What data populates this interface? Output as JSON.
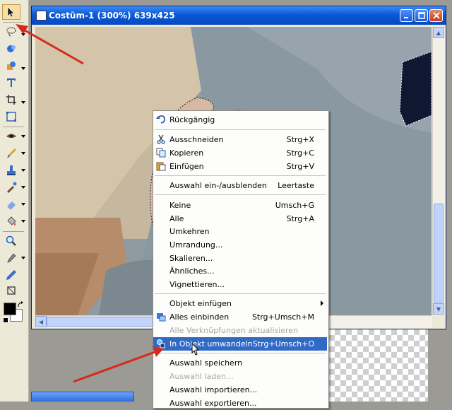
{
  "window": {
    "title": "Costüm-1 (300%) 639x425",
    "buttons": {
      "minimize": "minimize-icon",
      "maximize": "maximize-icon",
      "close": "close-icon"
    }
  },
  "toolbox": {
    "tools": [
      {
        "name": "pointer-tool",
        "icon": "arrow-pointer-icon",
        "active": true
      },
      {
        "name": "lasso-tool",
        "icon": "lasso-icon"
      },
      {
        "name": "magic-wand-tool",
        "icon": "magic-wand-icon"
      },
      {
        "name": "shape-tool",
        "icon": "shapes-icon"
      },
      {
        "name": "text-tool",
        "icon": "text-icon"
      },
      {
        "name": "crop-tool",
        "icon": "crop-icon"
      },
      {
        "name": "transform-tool",
        "icon": "transform-icon"
      },
      {
        "name": "eye-tool",
        "icon": "eye-icon"
      },
      {
        "name": "brush-tool",
        "icon": "brush-icon"
      },
      {
        "name": "stamp-tool",
        "icon": "stamp-icon"
      },
      {
        "name": "airbrush-tool",
        "icon": "airbrush-icon"
      },
      {
        "name": "eraser-tool",
        "icon": "eraser-icon"
      },
      {
        "name": "fill-tool",
        "icon": "paint-bucket-icon"
      },
      {
        "name": "zoom-tool",
        "icon": "magnifier-icon"
      },
      {
        "name": "eyedropper-tool",
        "icon": "eyedropper-icon"
      },
      {
        "name": "pen-tool",
        "icon": "pen-icon"
      },
      {
        "name": "hand-tool",
        "icon": "hand-icon"
      }
    ],
    "colors": {
      "foreground": "#000000",
      "background": "#ffffff"
    }
  },
  "context_menu": {
    "items": [
      {
        "label": "Rückgängig",
        "shortcut": "",
        "icon": "undo-icon"
      },
      {
        "label": "Ausschneiden",
        "shortcut": "Strg+X",
        "icon": "scissors-icon"
      },
      {
        "label": "Kopieren",
        "shortcut": "Strg+C",
        "icon": "copy-icon"
      },
      {
        "label": "Einfügen",
        "shortcut": "Strg+V",
        "icon": "paste-icon"
      },
      {
        "label": "Auswahl ein-/ausblenden",
        "shortcut": "Leertaste"
      },
      {
        "label": "Keine",
        "shortcut": "Umsch+G"
      },
      {
        "label": "Alle",
        "shortcut": "Strg+A"
      },
      {
        "label": "Umkehren",
        "shortcut": ""
      },
      {
        "label": "Umrandung...",
        "shortcut": ""
      },
      {
        "label": "Skalieren...",
        "shortcut": ""
      },
      {
        "label": "Ähnliches...",
        "shortcut": ""
      },
      {
        "label": "Vignettieren...",
        "shortcut": ""
      },
      {
        "label": "Objekt einfügen",
        "shortcut": "",
        "submenu": true
      },
      {
        "label": "Alles einbinden",
        "shortcut": "Strg+Umsch+M",
        "icon": "embed-icon"
      },
      {
        "label": "Alle Verknüpfungen aktualisieren",
        "shortcut": "",
        "disabled": true
      },
      {
        "label": "In Objekt umwandeln",
        "shortcut": "Strg+Umsch+O",
        "icon": "convert-object-icon",
        "highlighted": true
      },
      {
        "label": "Auswahl speichern",
        "shortcut": ""
      },
      {
        "label": "Auswahl laden...",
        "shortcut": "",
        "disabled": true
      },
      {
        "label": "Auswahl importieren...",
        "shortcut": ""
      },
      {
        "label": "Auswahl exportieren...",
        "shortcut": ""
      }
    ]
  },
  "colors": {
    "titlebar": "#0a58d6",
    "highlight": "#316ac5",
    "annotation_arrow": "#d42a1e"
  }
}
